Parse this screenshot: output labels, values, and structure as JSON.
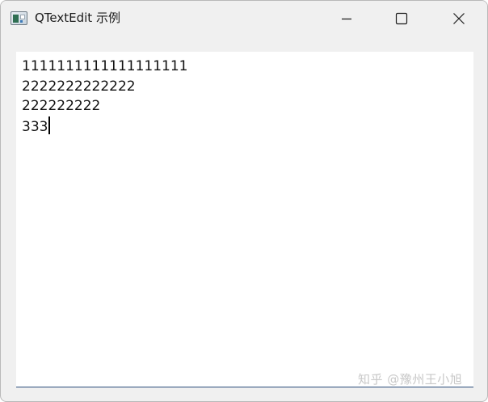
{
  "window": {
    "title": "QTextEdit 示例"
  },
  "icons": {
    "app": "app-window-icon",
    "minimize": "minimize-icon",
    "maximize": "maximize-icon",
    "close": "close-icon"
  },
  "editor": {
    "lines": [
      "1111111111111111111",
      "2222222222222",
      "222222222",
      "333"
    ]
  },
  "watermark": {
    "text": "知乎 @豫州王小旭"
  },
  "colors": {
    "titlebar_bg": "#f0f0f0",
    "editor_bg": "#ffffff",
    "editor_focus_border": "#2a4d7a"
  }
}
